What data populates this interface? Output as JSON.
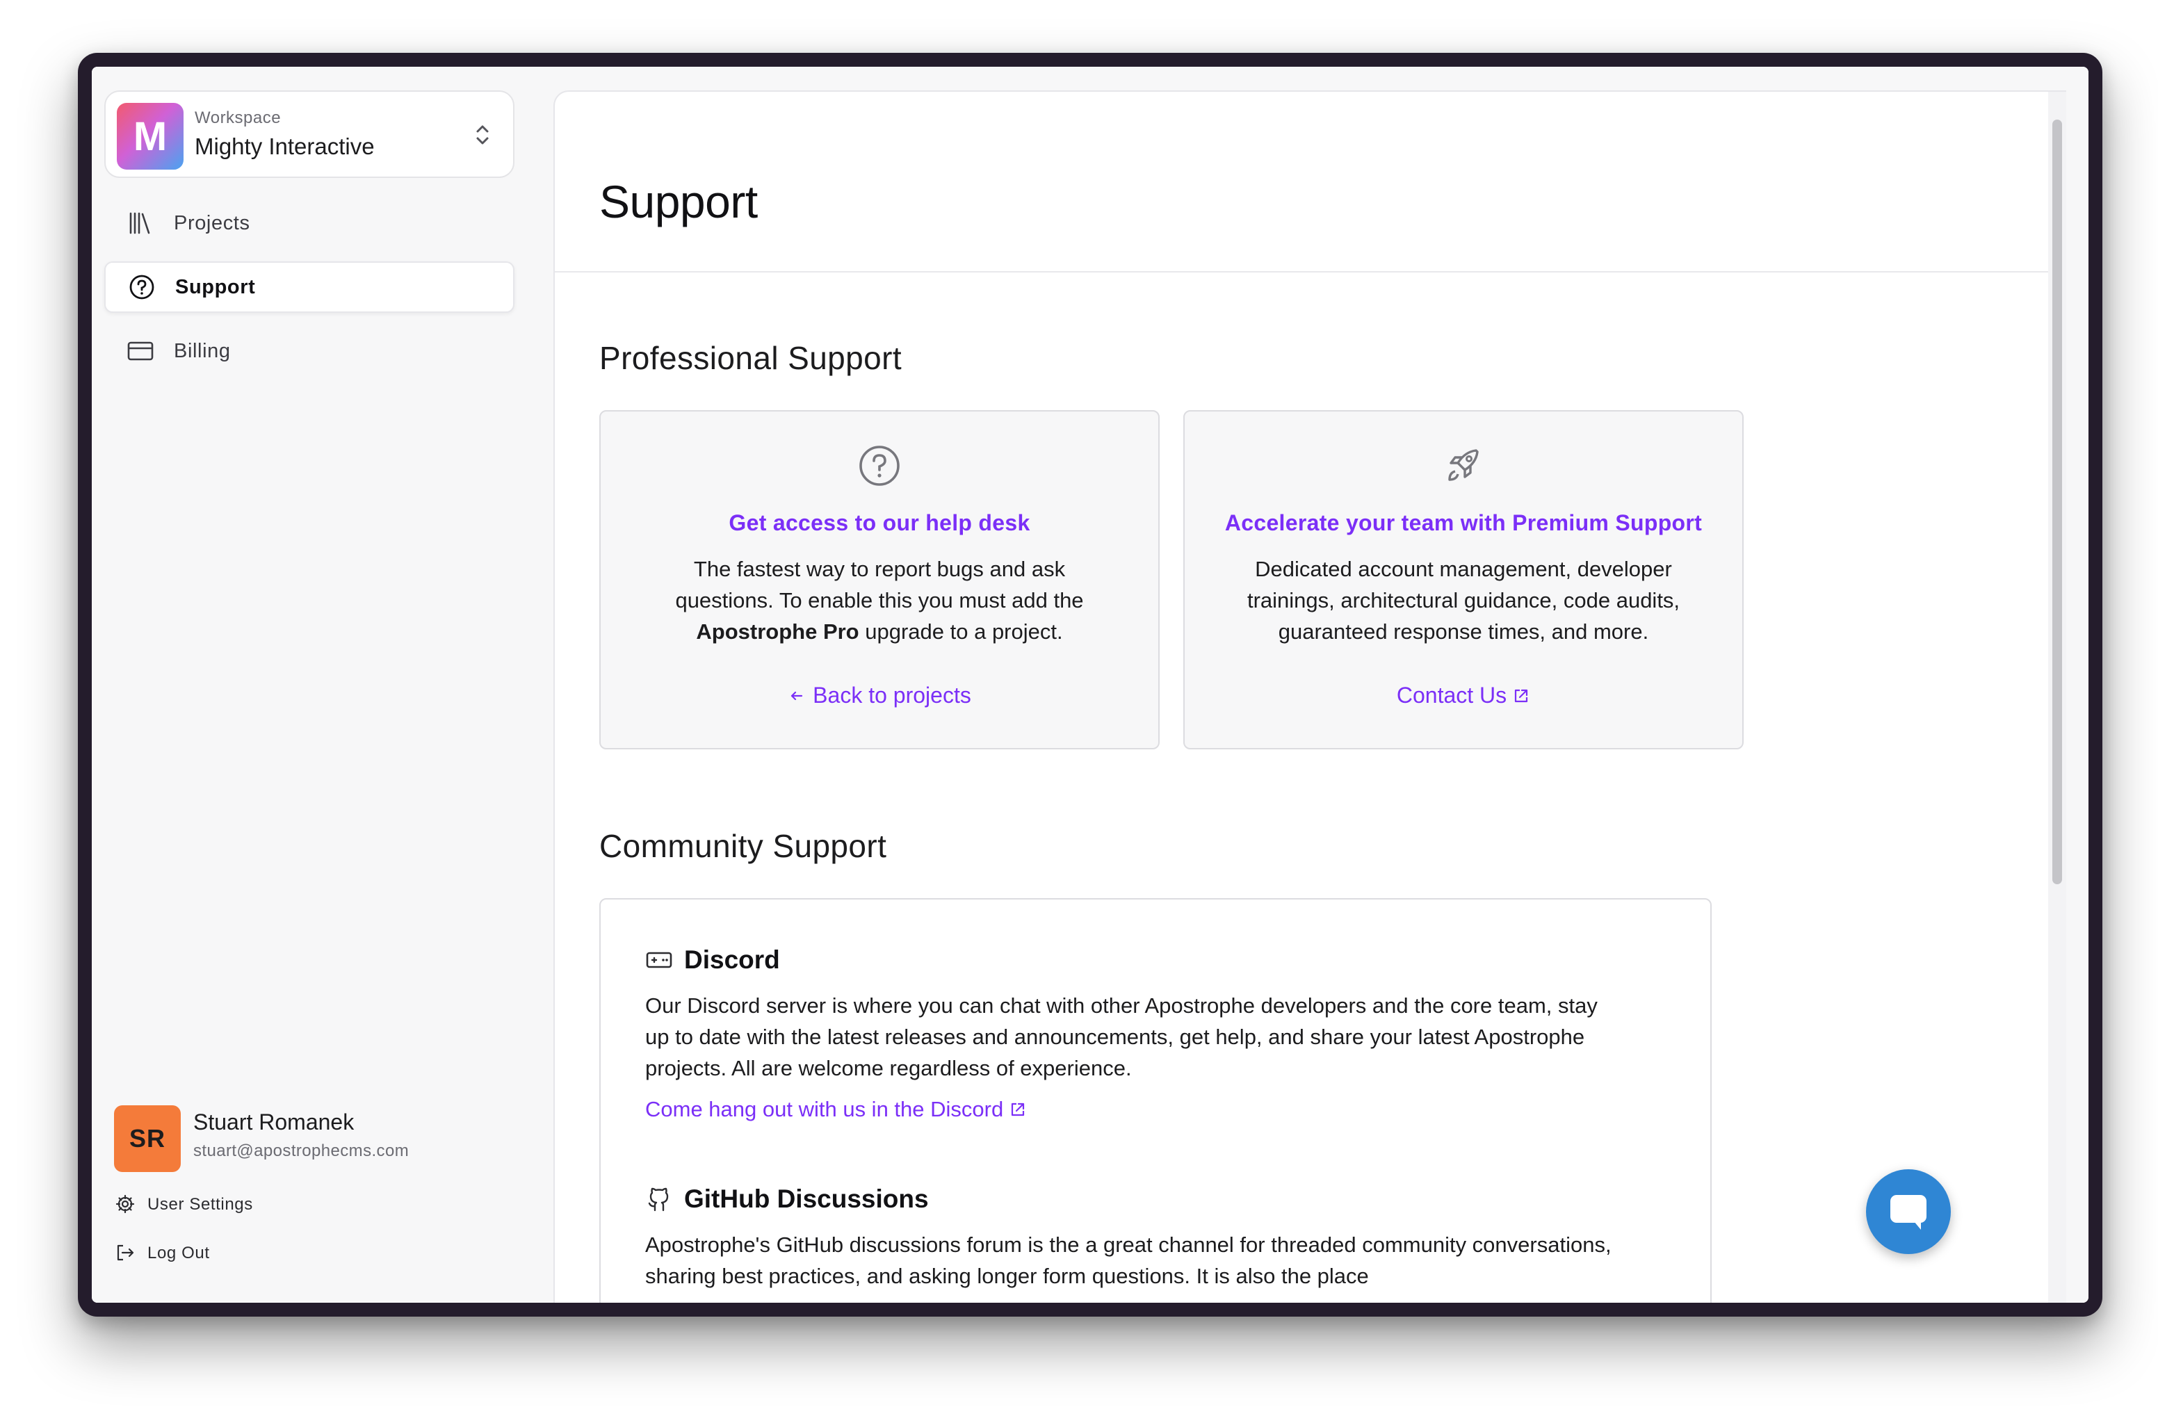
{
  "workspace": {
    "avatar_letter": "M",
    "label": "Workspace",
    "name": "Mighty Interactive"
  },
  "nav": {
    "items": [
      {
        "label": "Projects",
        "icon": "library-icon",
        "active": false
      },
      {
        "label": "Support",
        "icon": "help-circle-icon",
        "active": true
      },
      {
        "label": "Billing",
        "icon": "credit-card-icon",
        "active": false
      }
    ]
  },
  "user": {
    "initials": "SR",
    "name": "Stuart Romanek",
    "email": "stuart@apostrophecms.com",
    "settings_label": "User Settings",
    "logout_label": "Log Out"
  },
  "page": {
    "title": "Support"
  },
  "professional": {
    "title": "Professional Support",
    "cards": [
      {
        "icon": "help-circle-icon",
        "title": "Get access to our help desk",
        "body_pre": "The fastest way to report bugs and ask questions. To enable this you must add the ",
        "body_bold": "Apostrophe Pro",
        "body_post": " upgrade to a project.",
        "link": "Back to projects"
      },
      {
        "icon": "rocket-icon",
        "title": "Accelerate your team with Premium Support",
        "body": "Dedicated account management, developer trainings, architectural guidance, code audits, guaranteed response times, and more.",
        "link": "Contact Us"
      }
    ]
  },
  "community": {
    "title": "Community Support",
    "discord": {
      "title": "Discord",
      "body": "Our Discord server is where you can chat with other Apostrophe developers and the core team, stay up to date with the latest releases and announcements, get help, and share your latest Apostrophe projects. All are welcome regardless of experience.",
      "link": "Come hang out with us in the Discord"
    },
    "github": {
      "title": "GitHub Discussions",
      "body": "Apostrophe's GitHub discussions forum is the a great channel for threaded community conversations, sharing best practices, and asking longer form questions. It is also the place"
    }
  },
  "colors": {
    "accent": "#7b2ff7",
    "user_avatar": "#f47b3a",
    "chat_button": "#2f86d4"
  }
}
